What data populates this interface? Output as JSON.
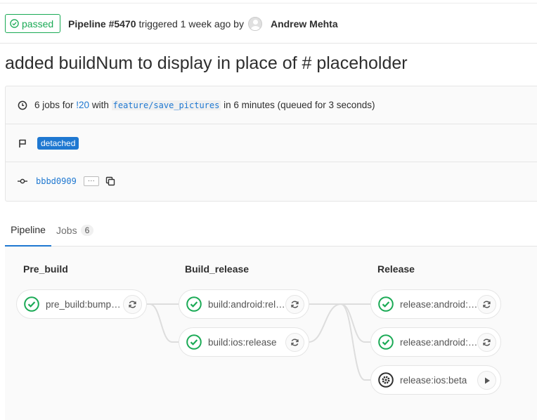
{
  "header": {
    "status": "passed",
    "pipeline_label": "Pipeline #5470",
    "triggered_text": "triggered 1 week ago by",
    "author": "Andrew Mehta"
  },
  "title": "added buildNum to display in place of # placeholder",
  "info": {
    "jobs_count_text": "6 jobs for",
    "mr_link": "!20",
    "with_text": "with",
    "branch": "feature/save_pictures",
    "duration_text": "in 6 minutes (queued for 3 seconds)",
    "badge": "detached",
    "commit_sha": "bbbd0909",
    "ellipsis": "···"
  },
  "tabs": {
    "pipeline": "Pipeline",
    "jobs": "Jobs",
    "jobs_count": "6"
  },
  "stages": [
    {
      "name": "Pre_build",
      "jobs": [
        {
          "name": "pre_build:bump_version",
          "status": "success",
          "action": "retry"
        }
      ]
    },
    {
      "name": "Build_release",
      "jobs": [
        {
          "name": "build:android:release",
          "status": "success",
          "action": "retry"
        },
        {
          "name": "build:ios:release",
          "status": "success",
          "action": "retry"
        }
      ]
    },
    {
      "name": "Release",
      "jobs": [
        {
          "name": "release:android:alpha",
          "status": "success",
          "action": "retry"
        },
        {
          "name": "release:android:internal",
          "status": "success",
          "action": "retry"
        },
        {
          "name": "release:ios:beta",
          "status": "manual",
          "action": "play"
        }
      ]
    }
  ],
  "colors": {
    "success": "#1aaa55",
    "link": "#1f78d1",
    "manual": "#2e2e2e"
  }
}
